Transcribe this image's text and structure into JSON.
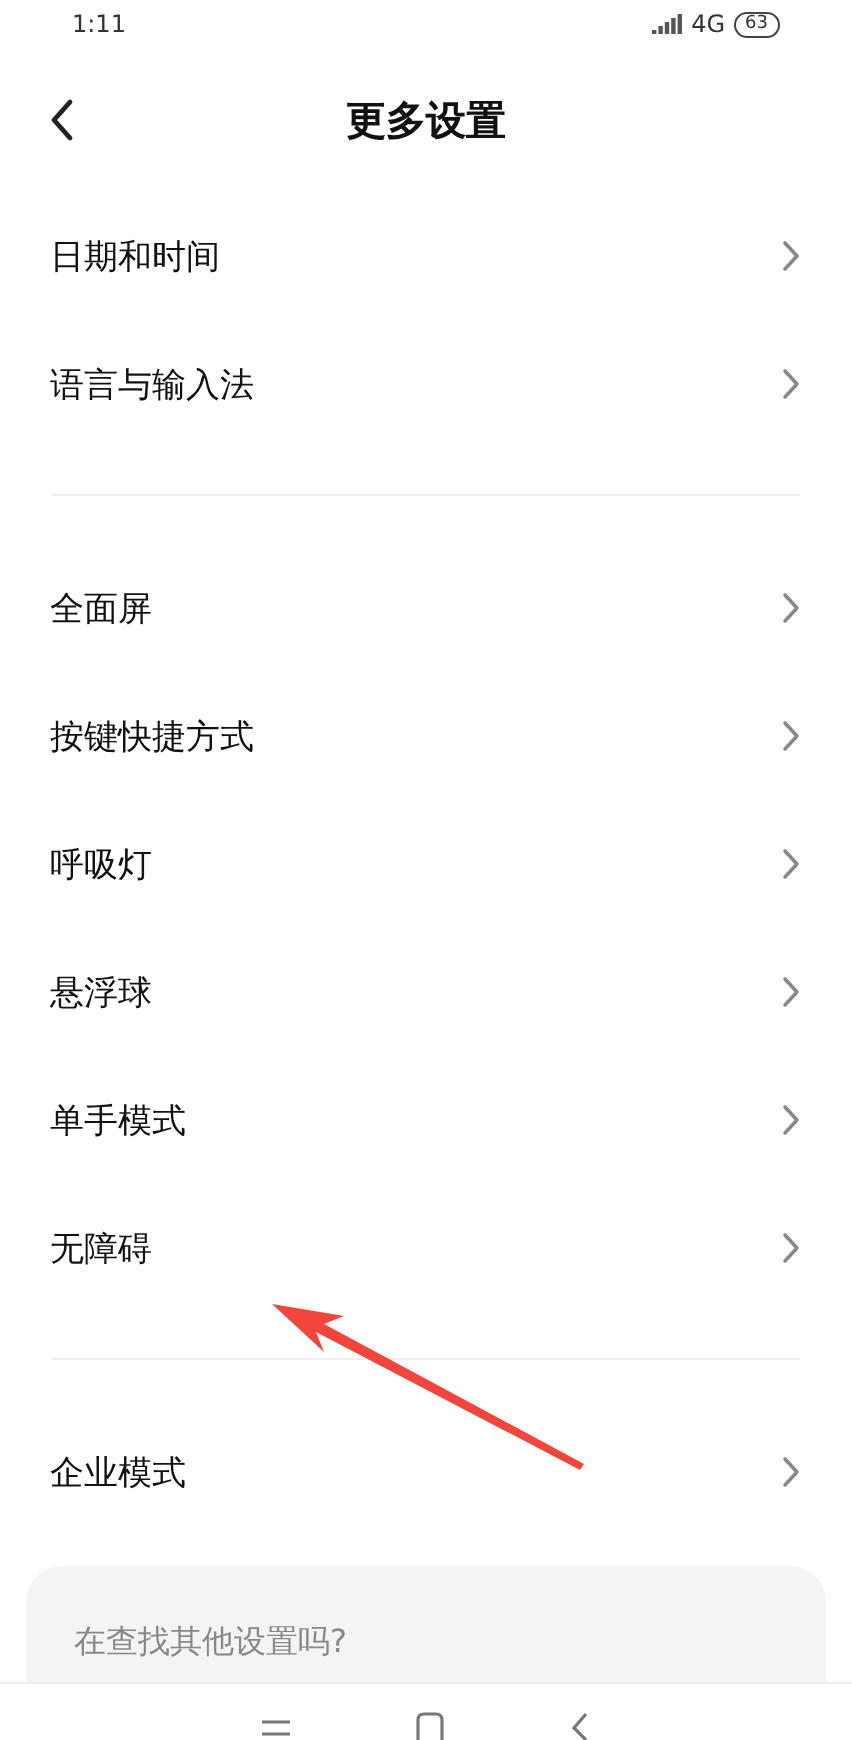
{
  "status_bar": {
    "time": "1:11",
    "network": "4G",
    "battery": "63"
  },
  "header": {
    "title": "更多设置"
  },
  "groups": [
    {
      "items": [
        {
          "label": "日期和时间"
        },
        {
          "label": "语言与输入法"
        }
      ]
    },
    {
      "items": [
        {
          "label": "全面屏"
        },
        {
          "label": "按键快捷方式"
        },
        {
          "label": "呼吸灯"
        },
        {
          "label": "悬浮球"
        },
        {
          "label": "单手模式"
        },
        {
          "label": "无障碍"
        }
      ]
    },
    {
      "items": [
        {
          "label": "企业模式"
        }
      ]
    }
  ],
  "search_card": {
    "text": "在查找其他设置吗?"
  }
}
